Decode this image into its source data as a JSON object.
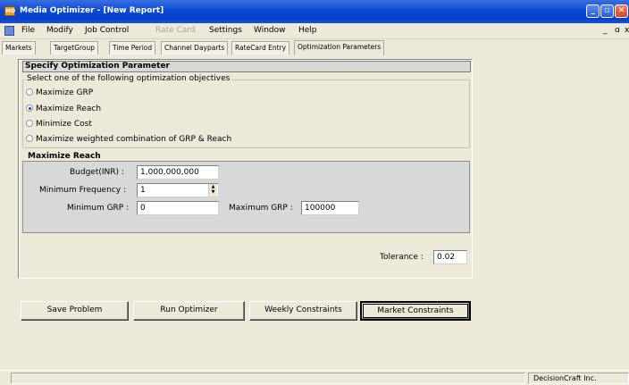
{
  "window": {
    "title": "Media Optimizer - [New Report]"
  },
  "menu": {
    "items": [
      "File",
      "Modify",
      "Job Control",
      "Rate Card",
      "Settings",
      "Window",
      "Help"
    ],
    "mdi_controls": "_ ܸ x"
  },
  "tabs": [
    "Markets",
    "TargetGroup",
    "Time Period",
    "Channel Dayparts",
    "RateCard Entry",
    "Optimization Parameters"
  ],
  "panel": {
    "header": "Specify Optimization Parameter",
    "objectives_legend": "Select one of the following optimization objectives",
    "objectives": [
      {
        "label": "Maximize GRP",
        "checked": false
      },
      {
        "label": "Maximize Reach",
        "checked": true
      },
      {
        "label": "Minimize Cost",
        "checked": false
      },
      {
        "label": "Maximize weighted combination of GRP & Reach",
        "checked": false
      }
    ],
    "reach_legend": "Maximize Reach",
    "budget_label": "Budget(INR) :",
    "budget_value": "1,000,000,000",
    "min_freq_label": "Minimum Frequency :",
    "min_freq_value": "1",
    "min_grp_label": "Minimum GRP :",
    "min_grp_value": "0",
    "max_grp_label": "Maximum GRP :",
    "max_grp_value": "100000",
    "tolerance_label": "Tolerance :",
    "tolerance_value": "0.02"
  },
  "buttons": {
    "save": "Save Problem",
    "run": "Run Optimizer",
    "weekly": "Weekly Constraints",
    "market": "Market Constraints"
  },
  "status": {
    "company": "DecisionCraft Inc."
  },
  "colors": {
    "titlebar": "#0a4ad6",
    "face": "#ece9d8"
  }
}
